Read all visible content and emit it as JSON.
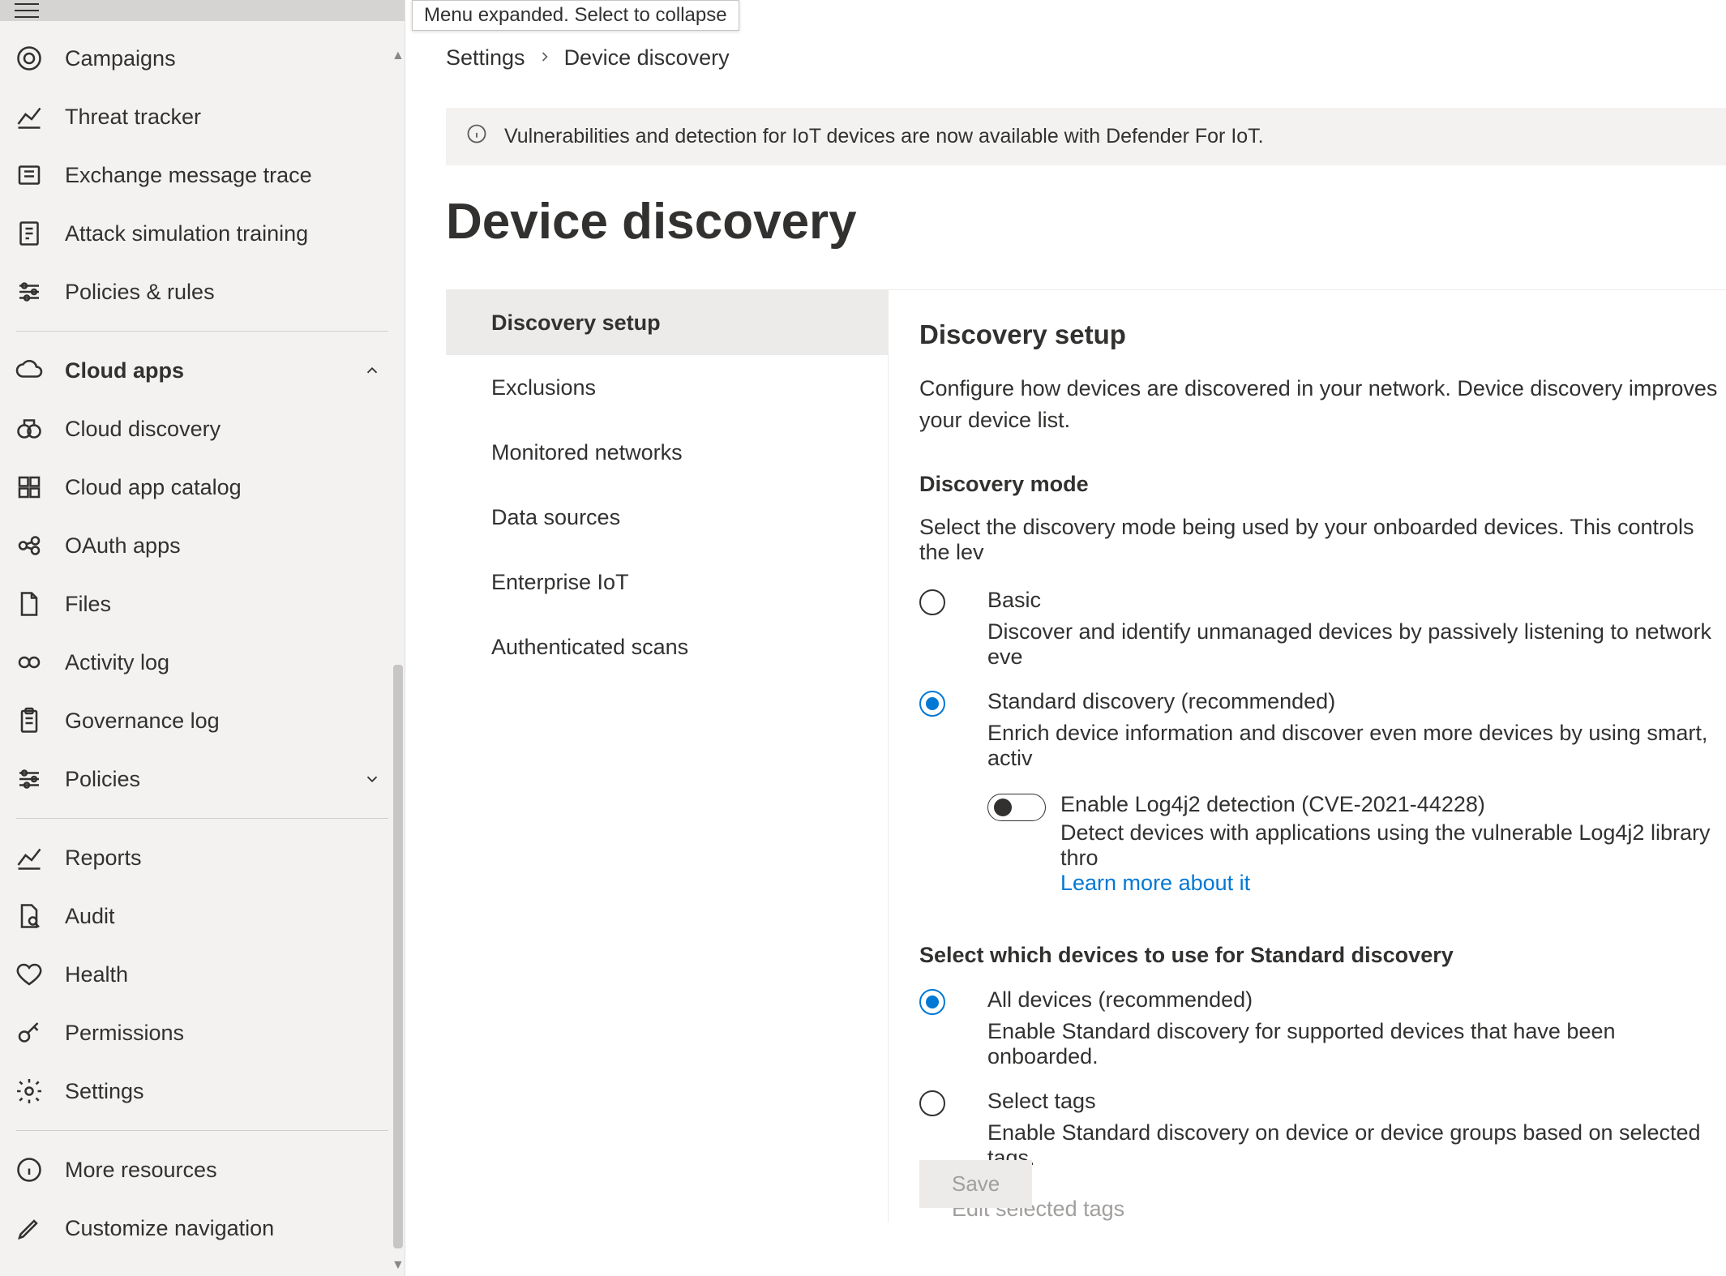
{
  "tooltip": "Menu expanded. Select to collapse",
  "sidebar": {
    "items": [
      {
        "label": "Campaigns",
        "icon": "target"
      },
      {
        "label": "Threat tracker",
        "icon": "trend"
      },
      {
        "label": "Exchange message trace",
        "icon": "exchange"
      },
      {
        "label": "Attack simulation training",
        "icon": "sim"
      },
      {
        "label": "Policies & rules",
        "icon": "sliders"
      }
    ],
    "cloud_label": "Cloud apps",
    "cloud_items": [
      {
        "label": "Cloud discovery",
        "icon": "binoculars"
      },
      {
        "label": "Cloud app catalog",
        "icon": "catalog"
      },
      {
        "label": "OAuth apps",
        "icon": "oauth"
      },
      {
        "label": "Files",
        "icon": "files"
      },
      {
        "label": "Activity log",
        "icon": "link"
      },
      {
        "label": "Governance log",
        "icon": "clipboard"
      },
      {
        "label": "Policies",
        "icon": "sliders",
        "chev": "down"
      }
    ],
    "bottom_items": [
      {
        "label": "Reports",
        "icon": "trend"
      },
      {
        "label": "Audit",
        "icon": "audit"
      },
      {
        "label": "Health",
        "icon": "heart"
      },
      {
        "label": "Permissions",
        "icon": "key"
      },
      {
        "label": "Settings",
        "icon": "gear"
      }
    ],
    "footer_items": [
      {
        "label": "More resources",
        "icon": "info"
      },
      {
        "label": "Customize navigation",
        "icon": "pencil"
      }
    ]
  },
  "breadcrumb": {
    "root": "Settings",
    "current": "Device discovery"
  },
  "info_bar": "Vulnerabilities and detection for IoT devices are now available with Defender For IoT.",
  "page_title": "Device discovery",
  "tabs": [
    "Discovery setup",
    "Exclusions",
    "Monitored networks",
    "Data sources",
    "Enterprise IoT",
    "Authenticated scans"
  ],
  "pane": {
    "title": "Discovery setup",
    "desc": "Configure how devices are discovered in your network. Device discovery improves your device list.",
    "mode_label": "Discovery mode",
    "mode_desc": "Select the discovery mode being used by your onboarded devices. This controls the lev",
    "basic_title": "Basic",
    "basic_desc": "Discover and identify unmanaged devices by passively listening to network eve",
    "standard_title": "Standard discovery (recommended)",
    "standard_desc": "Enrich device information and discover even more devices by using smart, activ",
    "log4j_title": "Enable Log4j2 detection (CVE-2021-44228)",
    "log4j_desc": "Detect devices with applications using the vulnerable Log4j2 library thro",
    "log4j_link": "Learn more about it",
    "select_label": "Select which devices to use for Standard discovery",
    "all_title": "All devices (recommended)",
    "all_desc": "Enable Standard discovery for supported devices that have been onboarded.",
    "tags_title": "Select tags",
    "tags_desc": "Enable Standard discovery on device or device groups based on selected tags.",
    "edit_tags": "Edit selected tags",
    "save": "Save"
  }
}
